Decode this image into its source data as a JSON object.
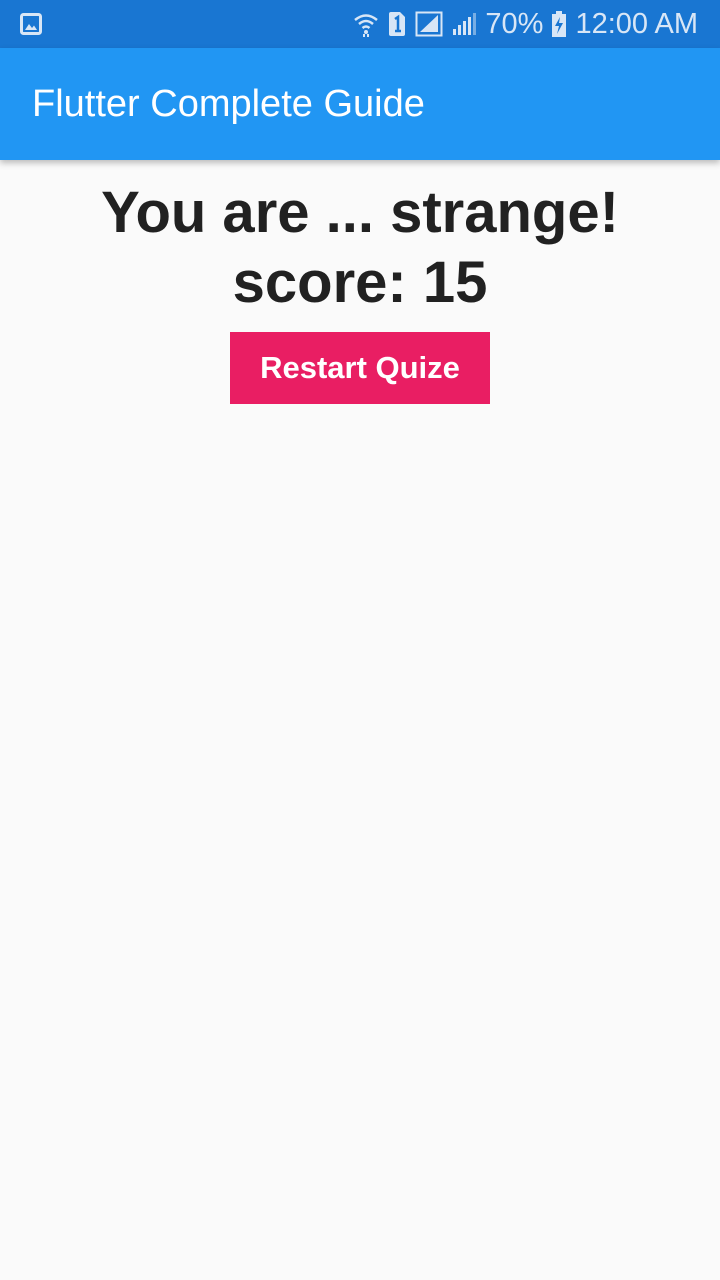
{
  "status_bar": {
    "icons": [
      "gallery-icon",
      "wifi-icon",
      "sim-1-icon",
      "signal-icon",
      "signal-icon",
      "battery-charging-icon"
    ],
    "battery": "70%",
    "time": "12:00 AM",
    "background": "#1976d2"
  },
  "app_bar": {
    "title": "Flutter Complete Guide",
    "background": "#2196f3"
  },
  "result": {
    "message": "You are ... strange!",
    "score_text": "score: 15",
    "text_color": "#212121"
  },
  "restart_button": {
    "label": "Restart Quize",
    "background": "#e91e63"
  }
}
